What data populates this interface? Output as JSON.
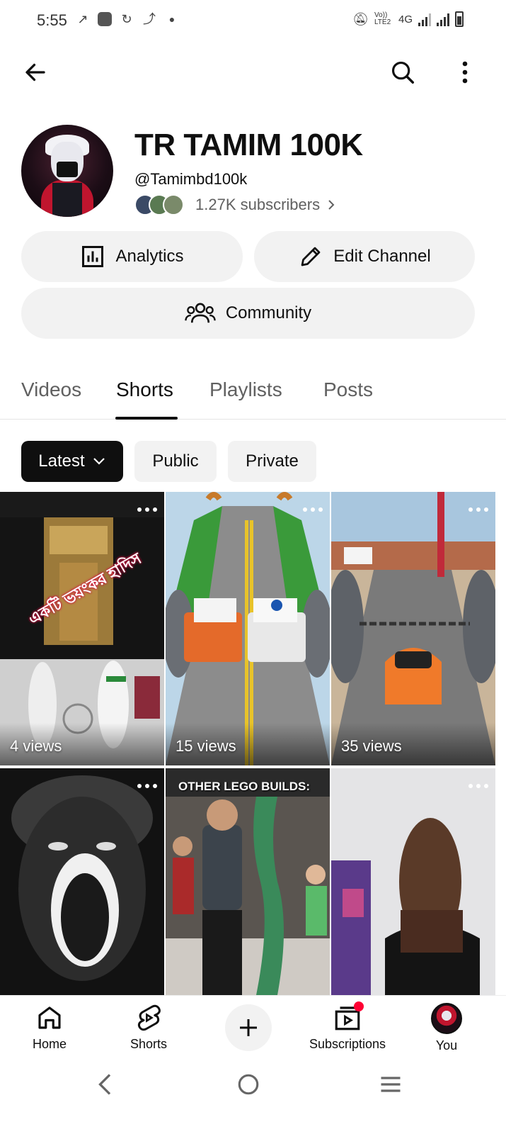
{
  "status_bar": {
    "time": "5:55",
    "network": "4G",
    "volte": "Vo)) LTE2"
  },
  "channel": {
    "name": "TR TAMIM 100K",
    "handle": "@Tamimbd100k",
    "subscribers": "1.27K subscribers"
  },
  "actions": {
    "analytics": "Analytics",
    "edit_channel": "Edit Channel",
    "community": "Community"
  },
  "tabs": [
    {
      "label": "Videos"
    },
    {
      "label": "Shorts"
    },
    {
      "label": "Playlists"
    },
    {
      "label": "Posts"
    }
  ],
  "active_tab": "Shorts",
  "filters": {
    "latest": "Latest",
    "public": "Public",
    "private": "Private"
  },
  "shorts": [
    {
      "views": "4 views",
      "overlay_text": "একটি ভয়ংকর হাদিস"
    },
    {
      "views": "15 views"
    },
    {
      "views": "35 views"
    },
    {
      "views": ""
    },
    {
      "views": "",
      "overlay_text": "OTHER LEGO BUILDS:"
    },
    {
      "views": ""
    }
  ],
  "bottom_nav": {
    "home": "Home",
    "shorts": "Shorts",
    "subscriptions": "Subscriptions",
    "you": "You"
  },
  "colors": {
    "text": "#0f0f0f",
    "secondary": "#606060",
    "chip_bg": "#f2f2f2",
    "chip_active_bg": "#0f0f0f",
    "notification": "#ff0033"
  }
}
